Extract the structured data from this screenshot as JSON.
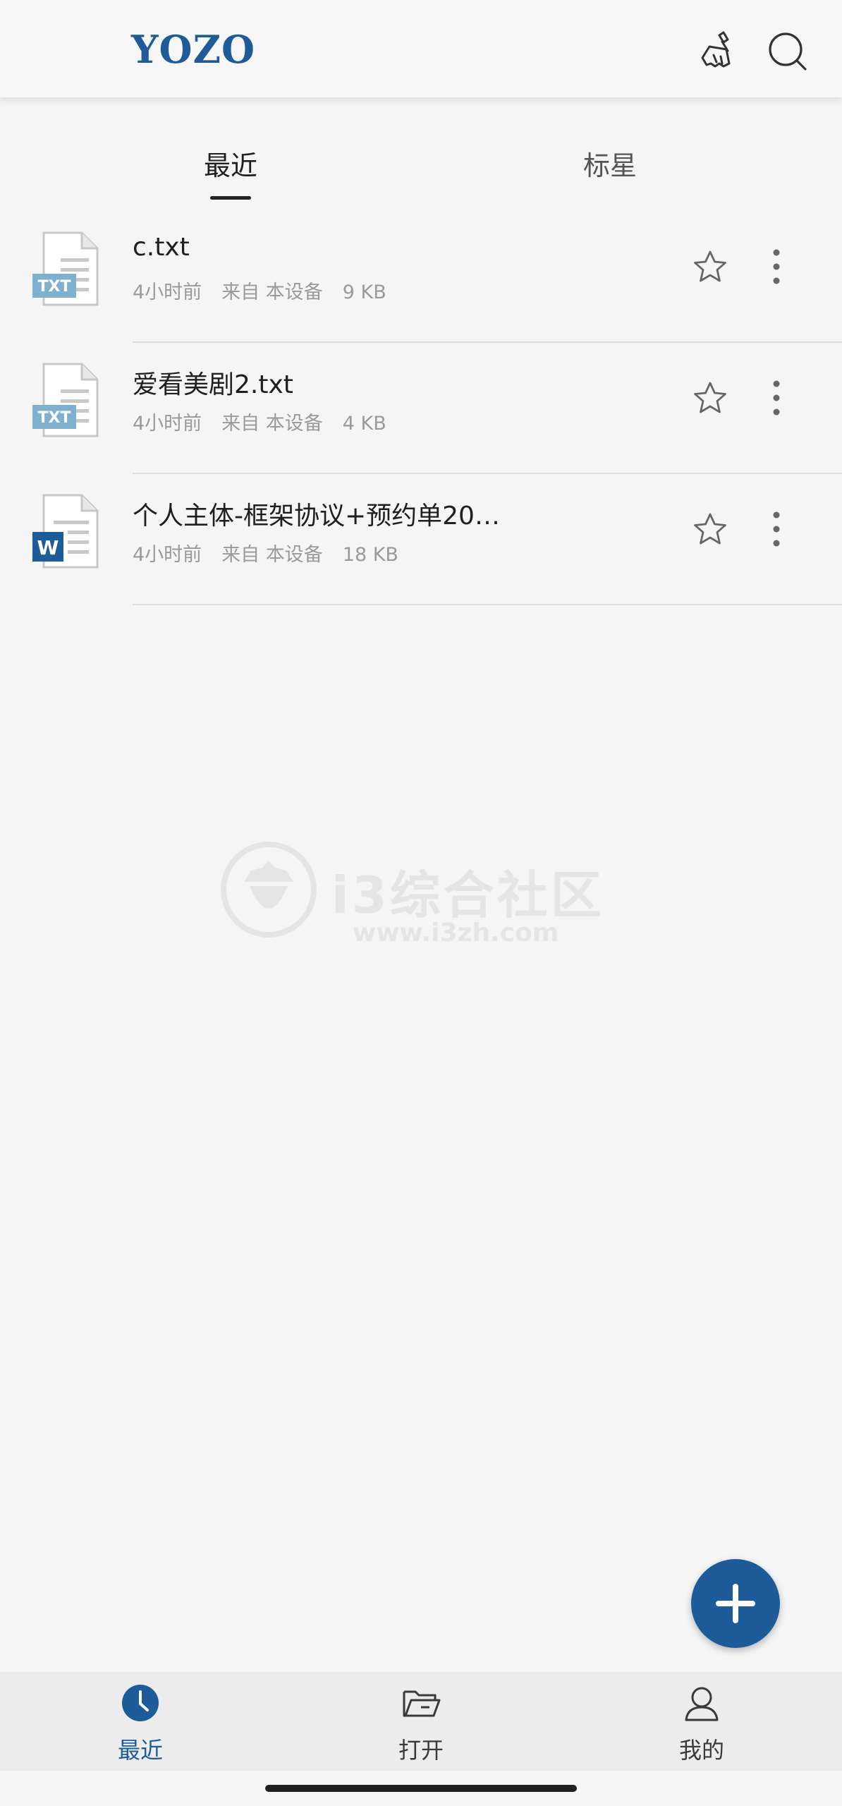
{
  "header": {
    "logo": "YOZO",
    "clean_icon": "broom-icon",
    "search_icon": "search-icon",
    "brand_color": "#1d5c98"
  },
  "tabs": [
    {
      "label": "最近",
      "active": true
    },
    {
      "label": "标星",
      "active": false
    }
  ],
  "files": [
    {
      "name": "c.txt",
      "type": "txt",
      "type_label": "TXT",
      "time": "4小时前",
      "source": "来自 本设备",
      "size": "9 KB",
      "starred": false
    },
    {
      "name": "爱看美剧2.txt",
      "type": "txt",
      "type_label": "TXT",
      "time": "4小时前",
      "source": "来自 本设备",
      "size": "4 KB",
      "starred": false
    },
    {
      "name": "个人主体-框架协议+预约单20…",
      "type": "doc",
      "type_label": "W",
      "time": "4小时前",
      "source": "来自 本设备",
      "size": "18 KB",
      "starred": false
    }
  ],
  "watermark": {
    "title": "i3综合社区",
    "url": "www.i3zh.com"
  },
  "fab": {
    "icon": "plus-icon"
  },
  "bottom_nav": [
    {
      "label": "最近",
      "icon": "clock-icon",
      "active": true
    },
    {
      "label": "打开",
      "icon": "folder-open-icon",
      "active": false
    },
    {
      "label": "我的",
      "icon": "user-icon",
      "active": false
    }
  ]
}
